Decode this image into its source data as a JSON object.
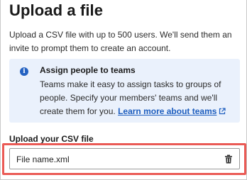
{
  "header": {
    "title": "Upload a file"
  },
  "intro": {
    "text": "Upload a CSV file with up to 500 users. We'll send them an invite to prompt them to create an account."
  },
  "info": {
    "icon": "info-icon",
    "title": "Assign people to teams",
    "body": "Teams make it easy to assign tasks to groups of people. Specify your members' teams and we'll create them for you.",
    "link_label": "Learn more about teams",
    "link_icon": "external-link-icon"
  },
  "upload": {
    "label": "Upload your CSV file",
    "file_name": "File name.xml",
    "delete_icon": "trash-icon"
  },
  "colors": {
    "accent": "#2462c2",
    "info_background": "#eaf1fc",
    "highlight": "#ea5a55"
  }
}
